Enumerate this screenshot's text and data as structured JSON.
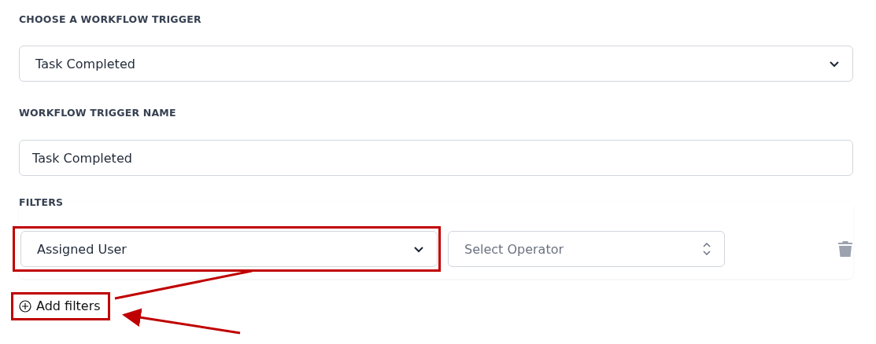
{
  "trigger": {
    "label": "CHOOSE A WORKFLOW TRIGGER",
    "value": "Task Completed"
  },
  "trigger_name": {
    "label": "WORKFLOW TRIGGER NAME",
    "value": "Task Completed"
  },
  "filters": {
    "label": "FILTERS",
    "rows": [
      {
        "field": "Assigned User",
        "operator_placeholder": "Select Operator",
        "highlighted": true
      }
    ],
    "add_button": {
      "label": "Add filters",
      "highlighted": true
    }
  }
}
